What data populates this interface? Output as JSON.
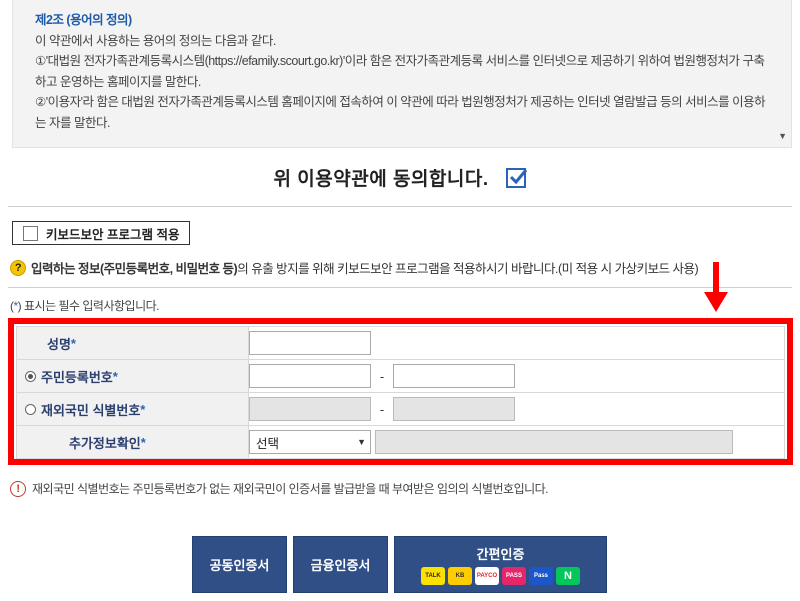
{
  "terms": {
    "title": "제2조 (용어의 정의)",
    "line1": "이 약관에서 사용하는 용어의 정의는 다음과 같다.",
    "line2": "①'대법원 전자가족관계등록시스템(https://efamily.scourt.go.kr)'이라 함은 전자가족관계등록 서비스를 인터넷으로 제공하기 위하여 법원행정처가 구축하고 운영하는 홈페이지를 말한다.",
    "line3": "②'이용자'라 함은 대법원 전자가족관계등록시스템 홈페이지에 접속하여 이 약관에 따라 법원행정처가 제공하는 인터넷 열람발급 등의 서비스를 이용하는 자를 말한다."
  },
  "agree": {
    "label": "위 이용약관에 동의합니다.",
    "checked": true
  },
  "keyboard": {
    "label": "키보드보안 프로그램 적용"
  },
  "notice": {
    "bold": "입력하는 정보(주민등록번호, 비밀번호 등)",
    "rest": "의 유출 방지를 위해 키보드보안 프로그램을 적용하시기 바랍니다.(미 적용 시 가상키보드 사용)"
  },
  "required_note": {
    "open": "(",
    "star": "*",
    "rest": ") 표시는 필수 입력사항입니다."
  },
  "form": {
    "name_label": "성명",
    "rrn_label": "주민등록번호",
    "foreign_label": "재외국민 식별번호",
    "extra_label": "추가정보확인",
    "star": "*",
    "dash": "-",
    "select_value": "선택"
  },
  "info": "재외국민 식별번호는 주민등록번호가 없는 재외국민이 인증서를 발급받을 때 부여받은 임의의 식별번호입니다.",
  "buttons": {
    "joint": "공동인증서",
    "financial": "금융인증서",
    "simple": "간편인증",
    "logos": [
      "TALK",
      "KB",
      "PAYCO",
      "PASS",
      "Pass",
      "N"
    ]
  },
  "colors": {
    "accent": "#2f4f86",
    "highlight": "#ff0000",
    "star": "#2a63b8"
  }
}
